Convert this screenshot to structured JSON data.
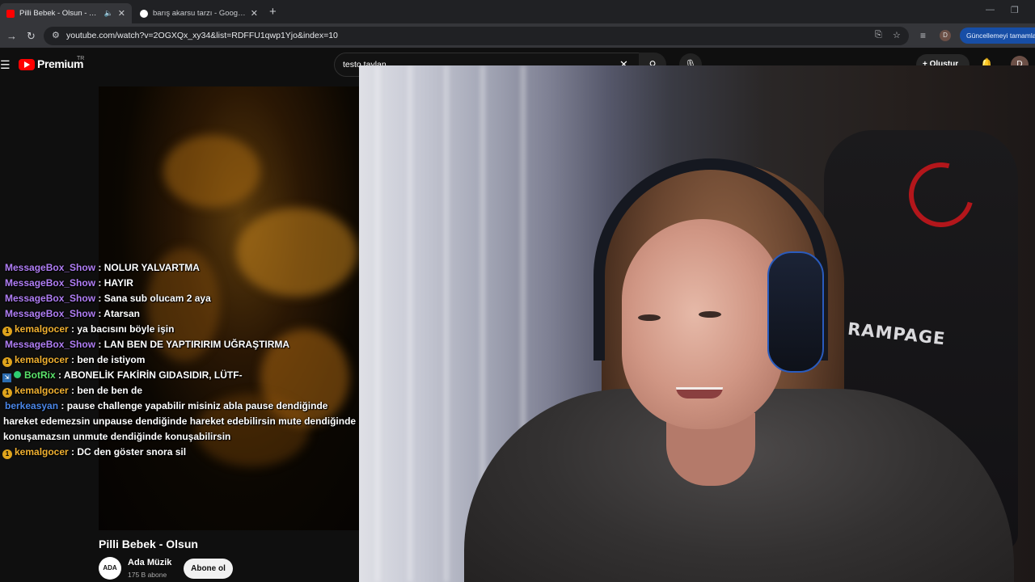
{
  "browser": {
    "tabs": [
      {
        "title": "Pilli Bebek - Olsun - YouTube",
        "active": true,
        "audio": true
      },
      {
        "title": "barış akarsu tarzı - Google'da Ara",
        "active": false,
        "audio": false
      }
    ],
    "new_tab": "+",
    "address": "youtube.com/watch?v=2OGXQx_xy34&list=RDFFU1qwp1Yjo&index=10",
    "profile_initial": "D",
    "update_button": "Güncellemeyi tamamla"
  },
  "youtube": {
    "logo_text": "Premium",
    "region": "TR",
    "search_query": "testo taylan",
    "create_label": "Oluştur",
    "avatar_initial": "D",
    "video_title": "Pilli Bebek - Olsun",
    "channel_avatar_text": "ADA",
    "channel_name": "Ada Müzik",
    "channel_subs": "175 B abone",
    "subscribe_label": "Abone ol"
  },
  "chat": {
    "messages": [
      {
        "user": "MessageBox_Show",
        "text": ": NOLUR YALVARTMA"
      },
      {
        "user": "MessageBox_Show",
        "text": ": HAYIR"
      },
      {
        "user": "MessageBox_Show",
        "text": ": Sana sub olucam 2 aya"
      },
      {
        "user": "MessageBox_Show",
        "text": ": Atarsan"
      },
      {
        "user": "kemalgocer",
        "text": ": ya bacısını böyle işin"
      },
      {
        "user": "MessageBox_Show",
        "text": ": LAN BEN DE YAPTIRIRIM UĞRAŞTIRMA"
      },
      {
        "user": "kemalgocer",
        "text": ": ben de istiyom"
      },
      {
        "user": "BotRix",
        "text": ": ABONELİK FAKİRİN GIDASIDIR, LÜTF-"
      },
      {
        "user": "kemalgocer",
        "text": ": ben de ben de"
      },
      {
        "user": "berkeasyan",
        "text": ": pause challenge yapabilir misiniz abla pause dendiğinde hareket edemezsin unpause dendiğinde hareket edebilirsin mute dendiğinde konuşamazsın unmute dendiğinde konuşabilirsin"
      },
      {
        "user": "kemalgocer",
        "text": ": DC den göster snora sil"
      }
    ],
    "colors": {
      "MessageBox_Show": "#b07ef5",
      "kemalgocer": "#f0b030",
      "BotRix": "#5be36b",
      "berkeasyan": "#4a86e8"
    }
  },
  "webcam": {
    "chair_brand": "RAMPAGE"
  },
  "icons": {
    "speaker": "speaker-icon",
    "close": "close-icon",
    "search": "search-icon",
    "mic": "mic-icon",
    "bell": "bell-icon"
  }
}
